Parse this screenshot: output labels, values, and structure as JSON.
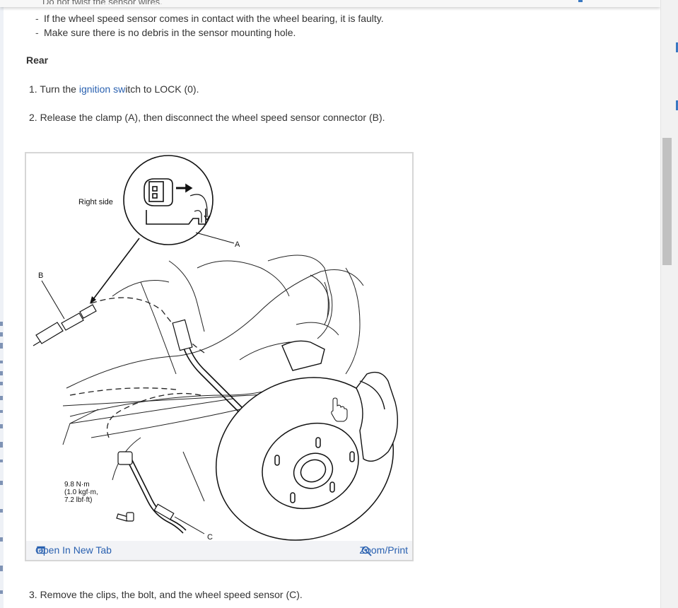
{
  "top_cut_text": "Do not twist the sensor wires.",
  "notes": [
    "If the wheel speed sensor comes in contact with the wheel bearing, it is faulty.",
    "Make sure there is no debris in the sensor mounting hole."
  ],
  "section_title": "Rear",
  "steps": {
    "s1_pre": "1. Turn the ",
    "s1_link": "ignition sw",
    "s1_post": "itch to LOCK (0).",
    "s2": "2. Release the clamp (A), then disconnect the wheel speed sensor connector (B).",
    "s3": "3. Remove the clips, the bolt, and the wheel speed sensor (C)."
  },
  "figure": {
    "label_right_side": "Right side",
    "label_a": "A",
    "label_b": "B",
    "label_c": "C",
    "torque_line1": "9.8 N·m",
    "torque_line2": "(1.0 kgf·m,",
    "torque_line3": "7.2 lbf·ft)",
    "open_tab_label": "Open In New Tab",
    "zoom_label": "Zoom/Print"
  },
  "icons": {
    "open_tab": "open-tab-icon",
    "zoom": "zoom-icon",
    "cursor": "hand-cursor-icon"
  },
  "colors": {
    "link": "#2a61b0",
    "text": "#333333",
    "bar_bg": "#f2f3f6"
  }
}
